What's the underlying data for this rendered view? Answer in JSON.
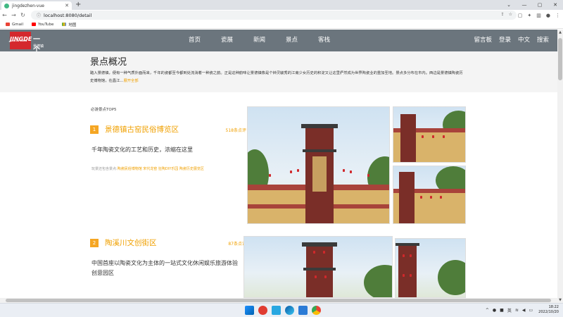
{
  "browser": {
    "tab_title": "jingdezhen-vue",
    "url": "localhost:8080/detail",
    "bookmarks": [
      "Gmail",
      "YouTube",
      "地图"
    ]
  },
  "site": {
    "logo_main": "JINGDE",
    "logo_tiny": "JING DE ZHEN",
    "logo_yige": "一个",
    "logo_sub": "景德镇",
    "nav": [
      "首页",
      "瓷展",
      "新闻",
      "景点",
      "客栈"
    ],
    "nav_right": [
      "留言板",
      "登录",
      "中文",
      "搜索"
    ]
  },
  "overview": {
    "title": "景点概况",
    "text": "踏入景德镇，便有一种气质扑面而来，千年的瓷都至今都到处流淌着一种瓷之韵。正是这种韵味让景德镇像是个钟灵毓秀的江南少女历史的积淀又让这里俨然成为世界陶瓷业的重加圣地。景点多分布在市内。西边是景德镇陶瓷历史博物馆，在昌江...",
    "more": "展开全部"
  },
  "top_label": "必游景点TOP5",
  "items": [
    {
      "rank": "1",
      "name": "景德镇古窑民俗博览区",
      "reviews": "518条点评",
      "desc": "千年陶瓷文化的工艺和历史，浓缩在这里",
      "tags_prefix": "玩景还包含景点:",
      "tags": "陶瓷民俗博物馆 宋代龙窑 狂陶DIY乐园 陶瓷历史展览区"
    },
    {
      "rank": "2",
      "name": "陶溪川文创街区",
      "reviews": "87条点评",
      "desc": "中国首座以陶瓷文化为主体的一站式文化休闲娱乐旅游体验创意园区"
    }
  ],
  "taskbar": {
    "time": "18:22",
    "date": "2022/10/20"
  }
}
